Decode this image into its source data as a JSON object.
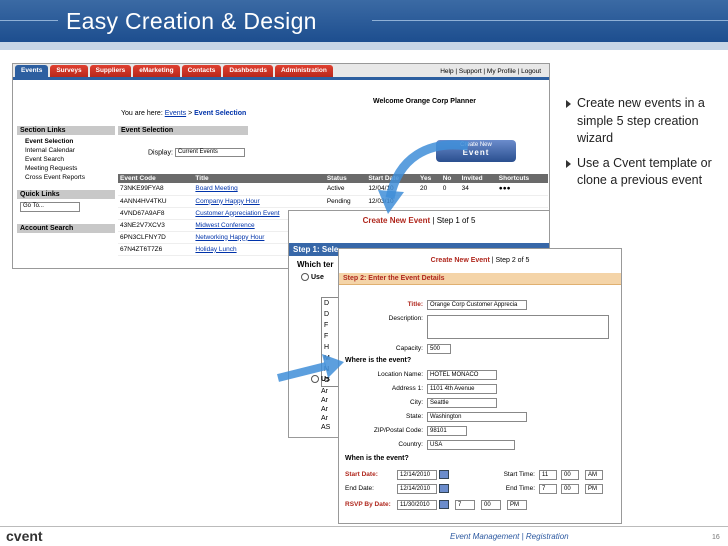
{
  "slide": {
    "title": "Easy Creation & Design",
    "bullets": [
      "Create new events in a simple 5 step creation wizard",
      "Use a Cvent template or clone a previous event"
    ],
    "footer": "Event Management | Registration",
    "page_number": "16",
    "logo": "cvent"
  },
  "app": {
    "tabs": [
      "Events",
      "Surveys",
      "Suppliers",
      "eMarketing",
      "Contacts",
      "Dashboards",
      "Administration"
    ],
    "top_links": "Help | Support | My Profile | Logout",
    "welcome": "Welcome Orange Corp Planner",
    "breadcrumb_prefix": "You are here:",
    "breadcrumb_link": "Events",
    "breadcrumb_sep": ">",
    "breadcrumb_current": "Event Selection",
    "section_links_title": "Section Links",
    "section_links": [
      "Event Selection",
      "Internal Calendar",
      "Event Search",
      "Meeting Requests",
      "Cross Event Reports"
    ],
    "quick_links_title": "Quick Links",
    "goto": "Go To...",
    "account_search_title": "Account Search",
    "event_selection_title": "Event Selection",
    "display_label": "Display:",
    "display_value": "Current Events",
    "create_btn_small": "Create New",
    "create_btn_big": "Event",
    "columns": [
      "Event Code",
      "Title",
      "Status",
      "Start Date",
      "Yes",
      "No",
      "Invited",
      "Shortcuts"
    ],
    "rows": [
      {
        "code": "73NKE99FYA8",
        "title": "Board Meeting",
        "status": "Active",
        "date": "12/04/10",
        "yes": "20",
        "no": "0",
        "invited": "34"
      },
      {
        "code": "4ANN4HV4TKU",
        "title": "Company Happy Hour",
        "status": "Pending",
        "date": "12/03/10",
        "yes": "",
        "no": "",
        "invited": ""
      },
      {
        "code": "4VND67A9AF8",
        "title": "Customer Appreciation Event",
        "status": "",
        "date": "",
        "yes": "",
        "no": "",
        "invited": ""
      },
      {
        "code": "43NE2V7XCV3",
        "title": "Midwest Conference",
        "status": "",
        "date": "",
        "yes": "",
        "no": "",
        "invited": ""
      },
      {
        "code": "6PN3CLFNY7D",
        "title": "Networking Happy Hour",
        "status": "",
        "date": "",
        "yes": "",
        "no": "",
        "invited": ""
      },
      {
        "code": "67N4ZT6T7Z6",
        "title": "Holiday Lunch",
        "status": "",
        "date": "",
        "yes": "",
        "no": "",
        "invited": ""
      }
    ]
  },
  "step1": {
    "header": "Create New Event",
    "step": "Step 1 of 5",
    "bar": "Step 1: Sele",
    "question": "Which ter",
    "opt1": "Use",
    "opt2": "Us",
    "list_letters": [
      "D",
      "D",
      "F",
      "F",
      "H",
      "M",
      "N",
      "O"
    ],
    "list2_letters": [
      "Ar",
      "Ar",
      "Ar",
      "Ar",
      "AS"
    ]
  },
  "step2": {
    "header": "Create New Event",
    "step": "Step 2 of 5",
    "bar": "Step 2: Enter the Event Details",
    "title_label": "Title:",
    "title_value": "Orange Corp Customer Apprecia",
    "description_label": "Description:",
    "capacity_label": "Capacity:",
    "capacity_value": "500",
    "where_heading": "Where is the event?",
    "location_label": "Location Name:",
    "location_value": "HOTEL MONACO",
    "address_label": "Address 1:",
    "address_value": "1101 4th Avenue",
    "city_label": "City:",
    "city_value": "Seattle",
    "state_label": "State:",
    "state_value": "Washington",
    "zip_label": "ZIP/Postal Code:",
    "zip_value": "98101",
    "country_label": "Country:",
    "country_value": "USA",
    "when_heading": "When is the event?",
    "start_date_label": "Start Date:",
    "start_date_value": "12/14/2010",
    "end_date_label": "End Date:",
    "end_date_value": "12/14/2010",
    "rsvp_label": "RSVP By Date:",
    "rsvp_value": "11/30/2010",
    "start_time_label": "Start Time:",
    "start_hour": "11",
    "start_min": "00",
    "start_ampm": "AM",
    "end_time_label": "End Time:",
    "end_hour": "7",
    "end_min": "00",
    "end_ampm": "PM",
    "rsvp_hour": "7",
    "rsvp_min": "00",
    "rsvp_ampm": "PM"
  }
}
